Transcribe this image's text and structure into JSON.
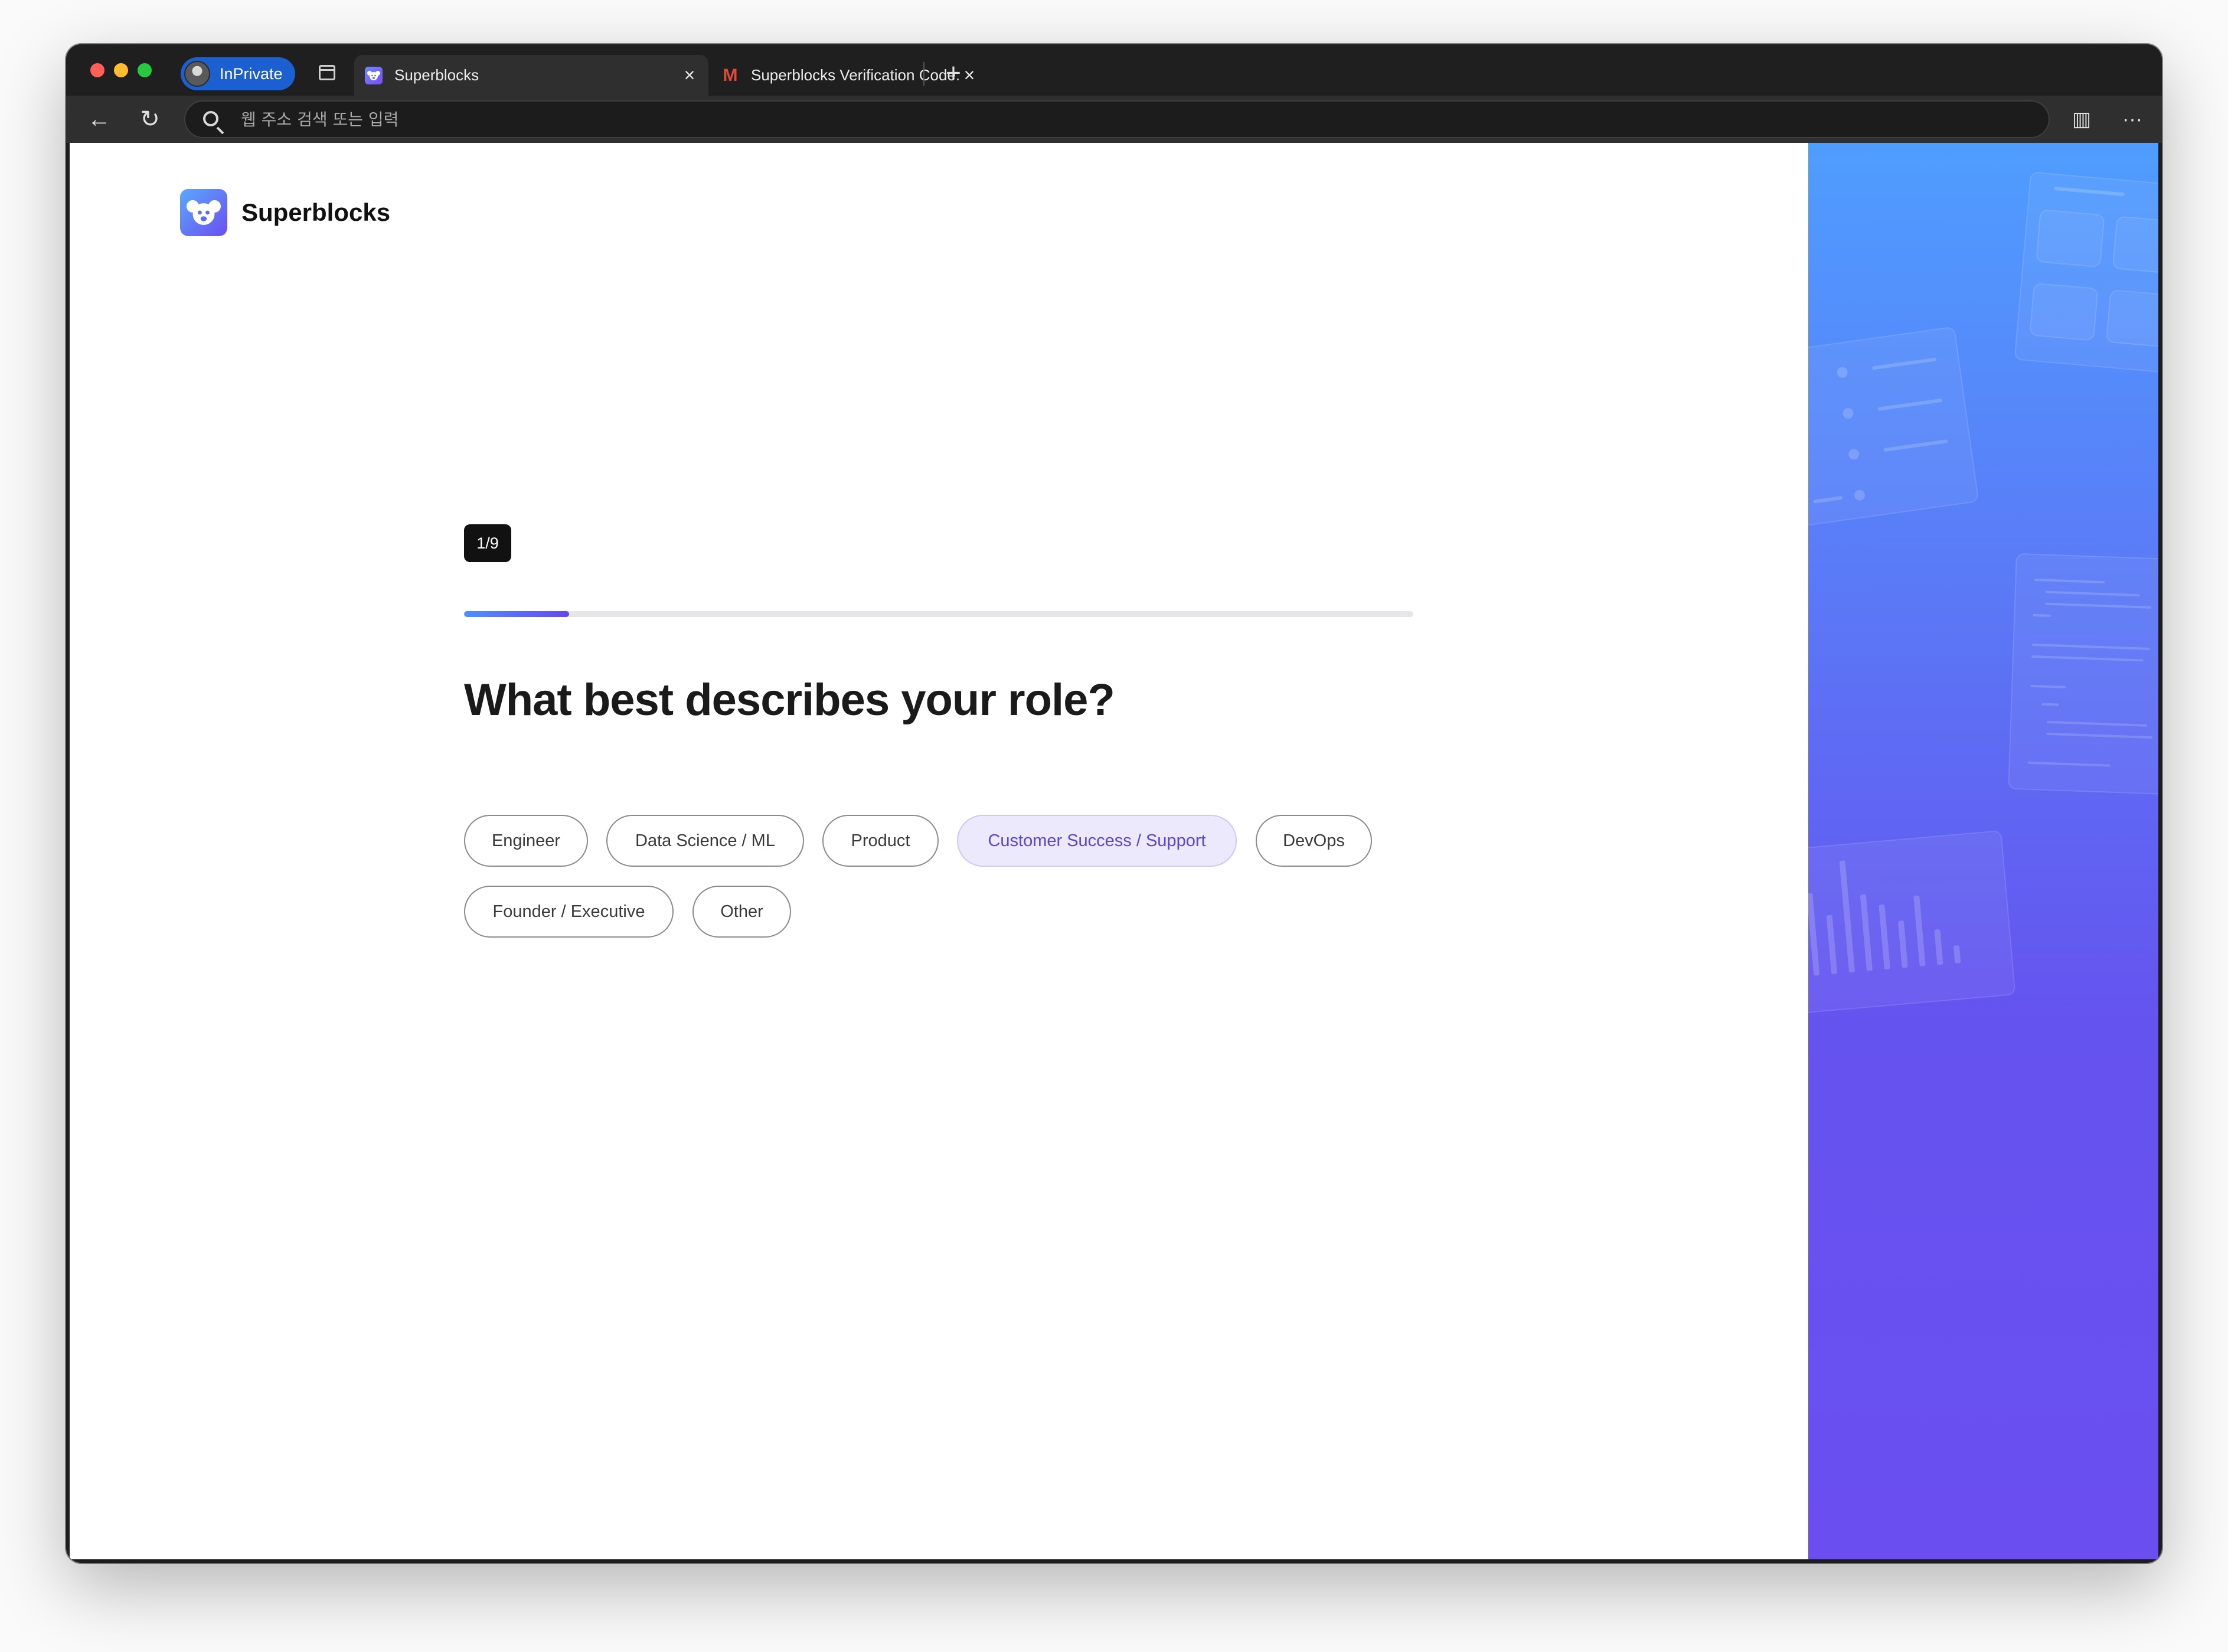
{
  "browser": {
    "profile_label": "InPrivate",
    "tabs": [
      {
        "title": "Superblocks",
        "favicon": "superblocks-favicon",
        "active": true,
        "close": "×"
      },
      {
        "title": "Superblocks Verification Code:",
        "favicon": "gmail-favicon",
        "active": false,
        "close": "×"
      }
    ],
    "new_tab": "+",
    "address_placeholder": "웹 주소 검색 또는 입력",
    "icons": {
      "back": "←",
      "refresh": "↻",
      "split": "▥",
      "more": "···"
    }
  },
  "page": {
    "brand_name": "Superblocks",
    "step": "1/9",
    "progress": 0.111,
    "question": "What best describes your role?",
    "options": [
      {
        "label": "Engineer",
        "selected": false
      },
      {
        "label": "Data Science / ML",
        "selected": false
      },
      {
        "label": "Product",
        "selected": false
      },
      {
        "label": "Customer Success / Support",
        "selected": true
      },
      {
        "label": "DevOps",
        "selected": false
      },
      {
        "label": "Founder / Executive",
        "selected": false
      },
      {
        "label": "Other",
        "selected": false
      }
    ]
  },
  "colors": {
    "accent": "#6548ee",
    "selected_bg": "#ece9fd",
    "selected_text": "#5b45d6",
    "panel_top": "#4f9dff",
    "panel_bottom": "#6b4ef0"
  }
}
